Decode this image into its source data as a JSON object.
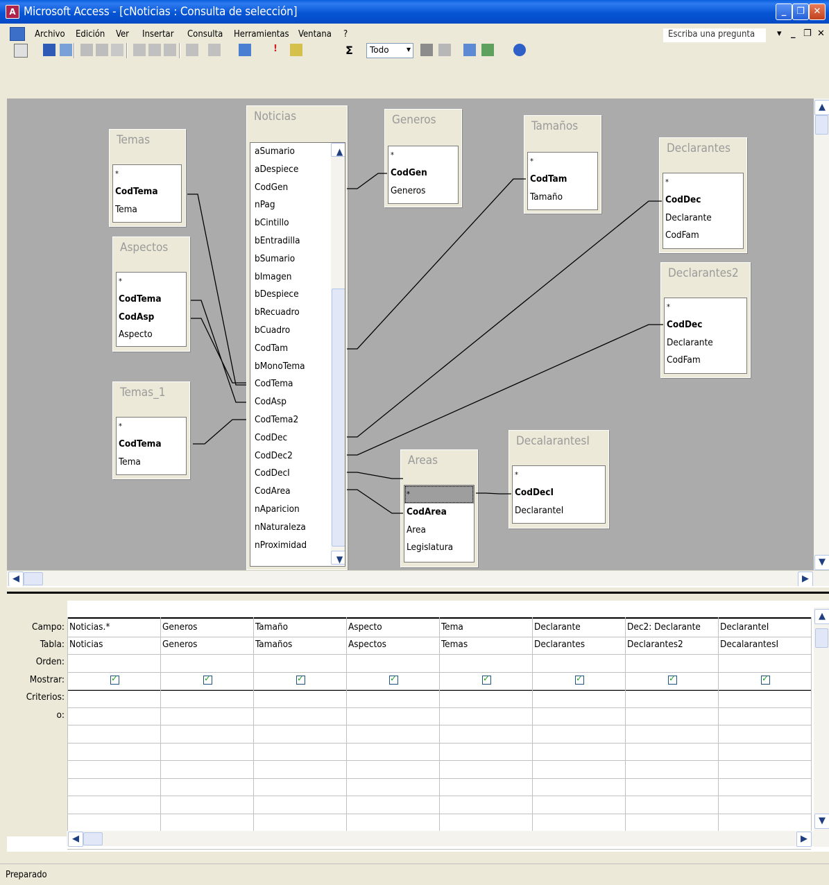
{
  "window": {
    "title": "Microsoft Access - [cNoticias : Consulta de selección]",
    "min_icon": "minimize-icon",
    "restore_icon": "restore-icon",
    "close_icon": "close-icon"
  },
  "menu": {
    "items": [
      "Archivo",
      "Edición",
      "Ver",
      "Insertar",
      "Consulta",
      "Herramientas",
      "Ventana",
      "?"
    ],
    "ask_placeholder": "Escriba una pregunta"
  },
  "toolbar": {
    "query_type_value": "Todo"
  },
  "tables": {
    "temas": {
      "title": "Temas",
      "fields": [
        "*",
        "CodTema",
        "Tema"
      ]
    },
    "aspectos": {
      "title": "Aspectos",
      "fields": [
        "*",
        "CodTema",
        "CodAsp",
        "Aspecto"
      ]
    },
    "temas_1": {
      "title": "Temas_1",
      "fields": [
        "*",
        "CodTema",
        "Tema"
      ]
    },
    "noticias": {
      "title": "Noticias",
      "fields": [
        "aSumario",
        "aDespiece",
        "CodGen",
        "nPag",
        "bCintillo",
        "bEntradilla",
        "bSumario",
        "bImagen",
        "bDespiece",
        "bRecuadro",
        "bCuadro",
        "CodTam",
        "bMonoTema",
        "CodTema",
        "CodAsp",
        "CodTema2",
        "CodDec",
        "CodDec2",
        "CodDecI",
        "CodArea",
        "nAparicion",
        "nNaturaleza",
        "nProximidad"
      ]
    },
    "generos": {
      "title": "Generos",
      "fields": [
        "*",
        "CodGen",
        "Generos"
      ]
    },
    "tamanos": {
      "title": "Tamaños",
      "fields": [
        "*",
        "CodTam",
        "Tamaño"
      ]
    },
    "declarantes": {
      "title": "Declarantes",
      "fields": [
        "*",
        "CodDec",
        "Declarante",
        "CodFam"
      ]
    },
    "declarantes2": {
      "title": "Declarantes2",
      "fields": [
        "*",
        "CodDec",
        "Declarante",
        "CodFam"
      ]
    },
    "areas": {
      "title": "Areas",
      "fields": [
        "*",
        "CodArea",
        "Area",
        "Legislatura"
      ]
    },
    "decalarantesI": {
      "title": "DecalarantesI",
      "fields": [
        "*",
        "CodDecI",
        "DeclaranteI"
      ]
    }
  },
  "grid": {
    "row_labels": [
      "Campo:",
      "Tabla:",
      "Orden:",
      "Mostrar:",
      "Criterios:",
      "o:"
    ],
    "columns": [
      {
        "campo": "Noticias.*",
        "tabla": "Noticias",
        "mostrar": true
      },
      {
        "campo": "Generos",
        "tabla": "Generos",
        "mostrar": true
      },
      {
        "campo": "Tamaño",
        "tabla": "Tamaños",
        "mostrar": true
      },
      {
        "campo": "Aspecto",
        "tabla": "Aspectos",
        "mostrar": true
      },
      {
        "campo": "Tema",
        "tabla": "Temas",
        "mostrar": true
      },
      {
        "campo": "Declarante",
        "tabla": "Declarantes",
        "mostrar": true
      },
      {
        "campo": "Dec2: Declarante",
        "tabla": "Declarantes2",
        "mostrar": true
      },
      {
        "campo": "DeclaranteI",
        "tabla": "DecalarantesI",
        "mostrar": true
      }
    ]
  },
  "status": {
    "text": "Preparado"
  }
}
